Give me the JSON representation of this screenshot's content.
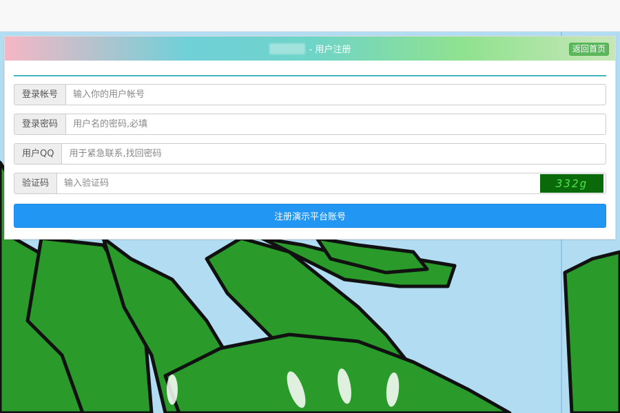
{
  "header": {
    "title": "- 用户注册",
    "home_label": "返回首页"
  },
  "form": {
    "account": {
      "label": "登录帐号",
      "placeholder": "输入你的用户帐号"
    },
    "password": {
      "label": "登录密码",
      "placeholder": "用户名的密码,必填"
    },
    "qq": {
      "label": "用户QQ",
      "placeholder": "用于紧急联系,找回密码"
    },
    "captcha": {
      "label": "验证码",
      "placeholder": "输入验证码",
      "code": "332g"
    },
    "submit_label": "注册演示平台账号"
  },
  "colors": {
    "accent": "#2196f3",
    "success": "#5cb85c",
    "divider": "#3fb5bd"
  }
}
